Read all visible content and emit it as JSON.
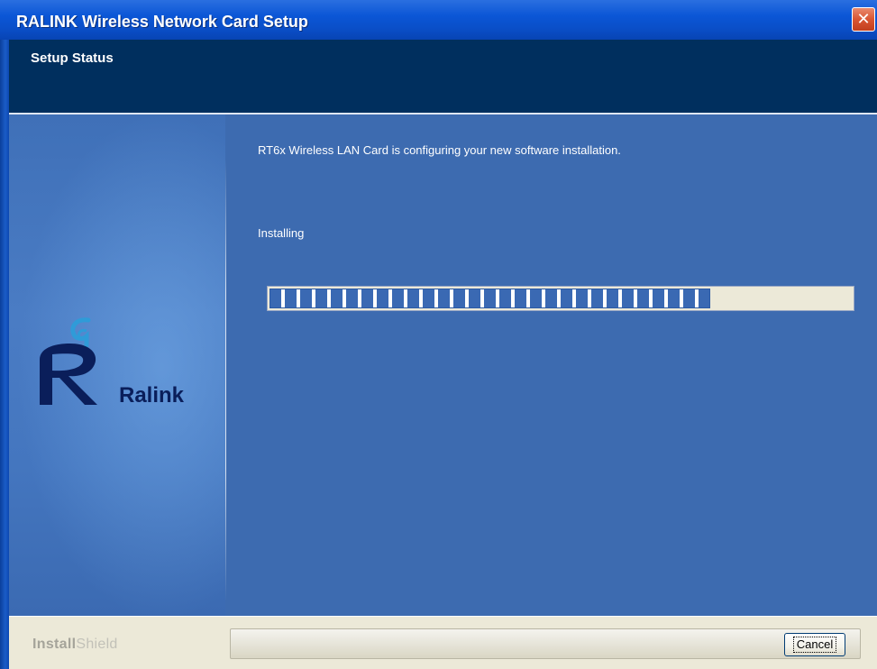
{
  "window": {
    "title": "RALINK Wireless Network Card Setup",
    "close_icon": "close-icon"
  },
  "header": {
    "title": "Setup Status"
  },
  "sidebar": {
    "logo_text": "Ralink",
    "logo_icon": "ralink-logo-icon"
  },
  "main": {
    "status_message": "RT6x Wireless LAN Card is configuring your new software installation.",
    "progress_label": "Installing",
    "progress_fraction": 0.78
  },
  "footer": {
    "brand_bold": "Install",
    "brand_light": "Shield",
    "cancel_label": "Cancel"
  },
  "colors": {
    "title_bar": "#0b56d6",
    "header_band": "#002f5e",
    "content_bg": "#3d6bb0",
    "progress_block": "#3a69b3",
    "footer_bg": "#ece9d8"
  }
}
